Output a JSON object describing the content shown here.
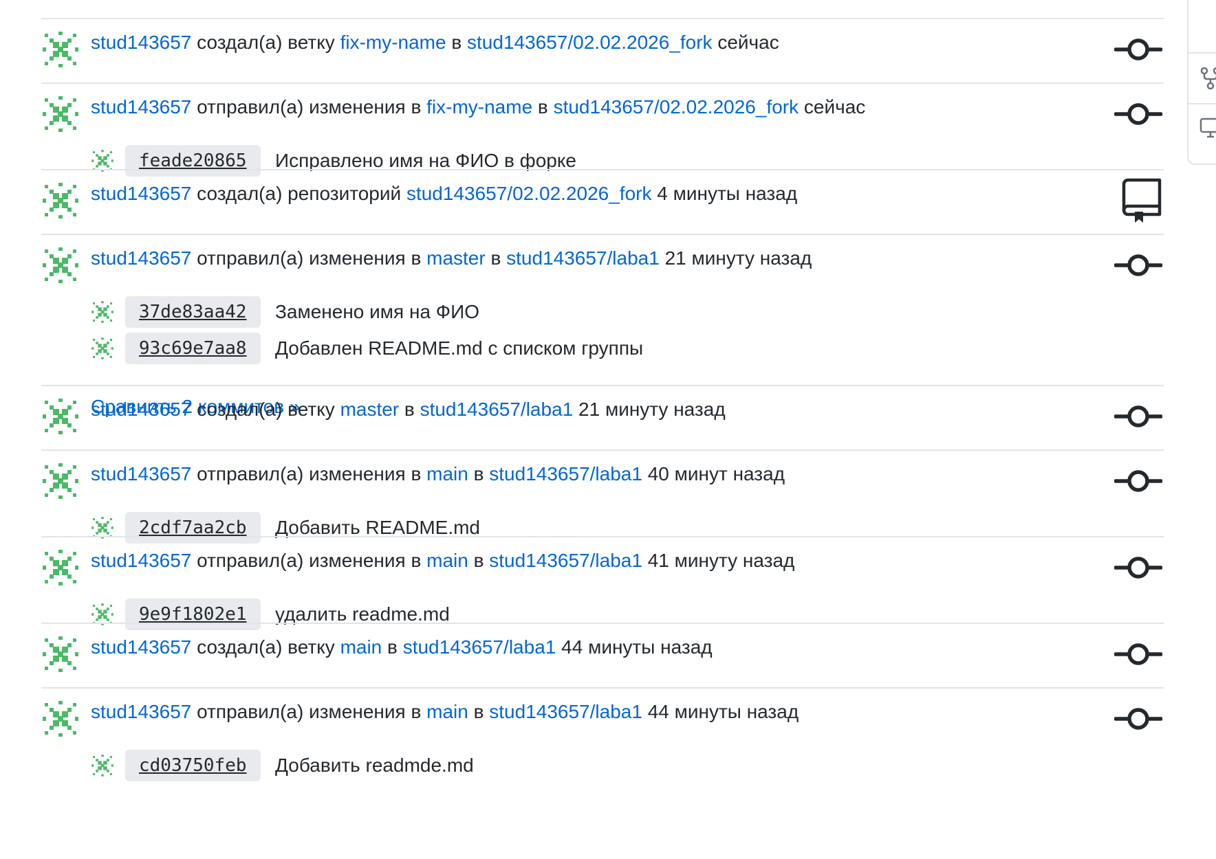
{
  "colors": {
    "link": "#0366d6",
    "text": "#24292e",
    "separator": "#e1e4e8",
    "sha_background": "#e8eaed",
    "avatar_green": "#4cb967",
    "icon": "#24292e"
  },
  "events": [
    {
      "user": "stud143657",
      "action": "создал(а) ветку",
      "ref": "fix-my-name",
      "connector": "в",
      "repo": "stud143657/02.02.2026_fork",
      "time": "сейчас",
      "icon": "git-commit-icon",
      "commits": []
    },
    {
      "user": "stud143657",
      "action": "отправил(а) изменения в",
      "ref": "fix-my-name",
      "connector": "в",
      "repo": "stud143657/02.02.2026_fork",
      "time": "сейчас",
      "icon": "git-commit-icon",
      "commits": [
        {
          "sha": "feade20865",
          "message": "Исправлено имя на ФИО в форке"
        }
      ]
    },
    {
      "user": "stud143657",
      "action": "создал(а) репозиторий",
      "repo": "stud143657/02.02.2026_fork",
      "time": "4 минуты назад",
      "icon": "repo-icon",
      "commits": []
    },
    {
      "user": "stud143657",
      "action": "отправил(а) изменения в",
      "ref": "master",
      "connector": "в",
      "repo": "stud143657/laba1",
      "time": "21 минуту назад",
      "icon": "git-commit-icon",
      "commits": [
        {
          "sha": "37de83aa42",
          "message": "Заменено имя на ФИО"
        },
        {
          "sha": "93c69e7aa8",
          "message": "Добавлен README.md с списком группы"
        }
      ],
      "compare_label": "Сравнить 2 коммитов »"
    },
    {
      "user": "stud143657",
      "action": "создал(а) ветку",
      "ref": "master",
      "connector": "в",
      "repo": "stud143657/laba1",
      "time": "21 минуту назад",
      "icon": "git-commit-icon",
      "commits": []
    },
    {
      "user": "stud143657",
      "action": "отправил(а) изменения в",
      "ref": "main",
      "connector": "в",
      "repo": "stud143657/laba1",
      "time": "40 минут назад",
      "icon": "git-commit-icon",
      "commits": [
        {
          "sha": "2cdf7aa2cb",
          "message": "Добавить README.md"
        }
      ]
    },
    {
      "user": "stud143657",
      "action": "отправил(а) изменения в",
      "ref": "main",
      "connector": "в",
      "repo": "stud143657/laba1",
      "time": "41 минуту назад",
      "icon": "git-commit-icon",
      "commits": [
        {
          "sha": "9e9f1802e1",
          "message": "удалить readme.md"
        }
      ]
    },
    {
      "user": "stud143657",
      "action": "создал(а) ветку",
      "ref": "main",
      "connector": "в",
      "repo": "stud143657/laba1",
      "time": "44 минуты назад",
      "icon": "git-commit-icon",
      "commits": []
    },
    {
      "user": "stud143657",
      "action": "отправил(а) изменения в",
      "ref": "main",
      "connector": "в",
      "repo": "stud143657/laba1",
      "time": "44 минуты назад",
      "icon": "git-commit-icon",
      "commits": [
        {
          "sha": "cd03750feb",
          "message": "Добавить readmde.md"
        }
      ]
    }
  ],
  "side_panel": {
    "items": [
      {
        "icon": "fork-icon"
      },
      {
        "icon": "desktop-icon"
      }
    ]
  }
}
